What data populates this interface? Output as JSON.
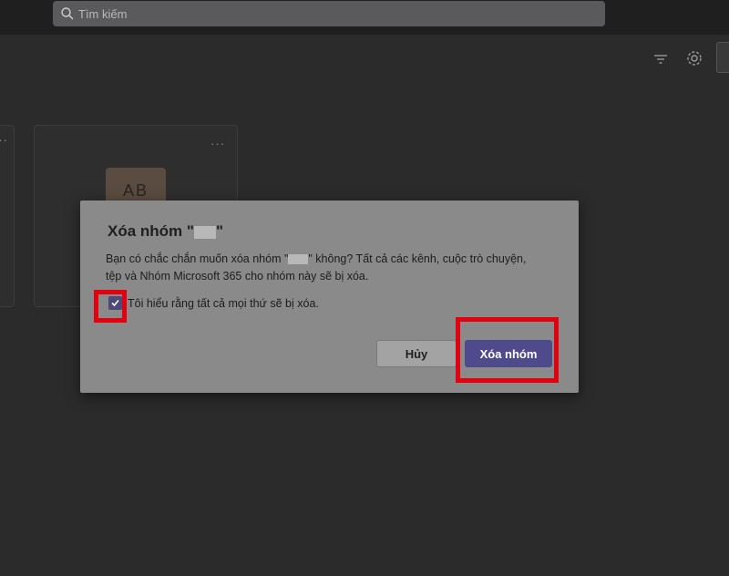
{
  "search": {
    "placeholder": "Tìm kiếm"
  },
  "cards": {
    "avatar_initials": "AB",
    "more_dots": "···"
  },
  "dialog": {
    "title_prefix": "Xóa nhóm \"",
    "title_suffix": "\"",
    "body_line1_prefix": "Bạn có chắc chắn muốn xóa nhóm \"",
    "body_line1_suffix": "\" không? Tất cả các kênh, cuộc trò chuyện,",
    "body_line2": "tệp và Nhóm Microsoft 365 cho nhóm này sẽ bị xóa.",
    "checkbox_label": "Tôi hiểu rằng tất cả mọi thứ sẽ bị xóa.",
    "checkbox_checked": true,
    "cancel_label": "Hủy",
    "delete_label": "Xóa nhóm"
  },
  "colors": {
    "accent": "#4f4a8c",
    "highlight": "#e3000f"
  }
}
